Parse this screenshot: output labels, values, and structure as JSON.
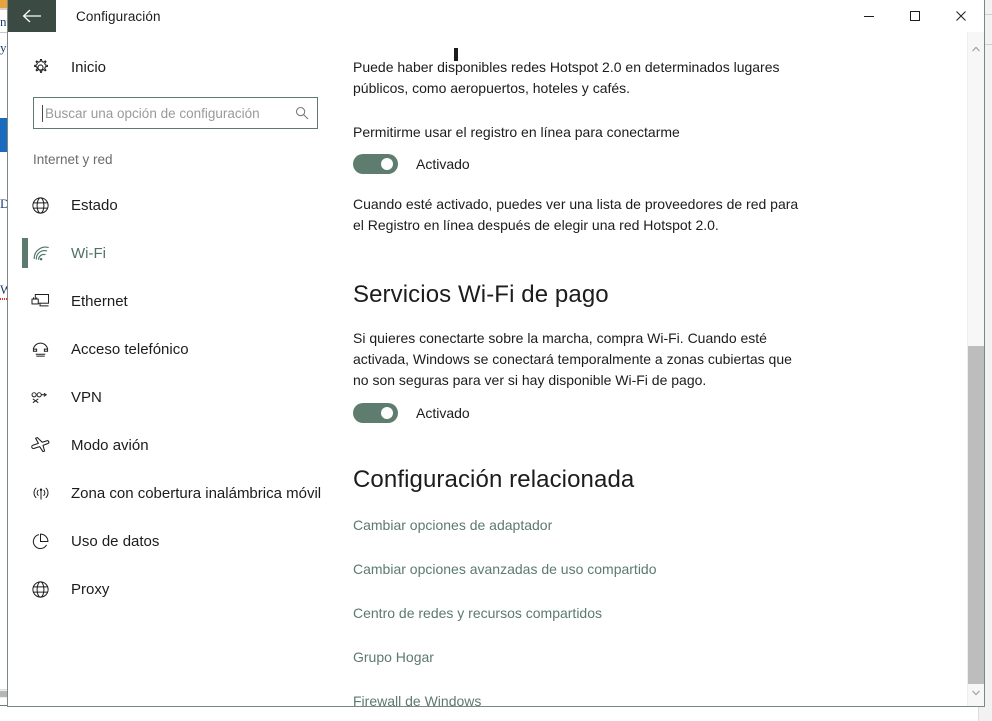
{
  "window": {
    "title": "Configuración",
    "back_icon": "back-arrow-icon",
    "minimize_label": "Minimizar",
    "maximize_label": "Maximizar",
    "close_label": "Cerrar"
  },
  "sidebar": {
    "home": {
      "label": "Inicio",
      "icon": "gear-icon"
    },
    "search": {
      "placeholder": "Buscar una opción de configuración",
      "value": "",
      "icon": "search-icon"
    },
    "section_title": "Internet y red",
    "items": [
      {
        "label": "Estado",
        "icon": "globe-icon",
        "selected": false
      },
      {
        "label": "Wi-Fi",
        "icon": "wifi-icon",
        "selected": true
      },
      {
        "label": "Ethernet",
        "icon": "ethernet-icon",
        "selected": false
      },
      {
        "label": "Acceso telefónico",
        "icon": "dialup-phone-icon",
        "selected": false
      },
      {
        "label": "VPN",
        "icon": "vpn-icon",
        "selected": false
      },
      {
        "label": "Modo avión",
        "icon": "airplane-icon",
        "selected": false
      },
      {
        "label": "Zona con cobertura inalámbrica móvil",
        "icon": "hotspot-icon",
        "selected": false
      },
      {
        "label": "Uso de datos",
        "icon": "pie-chart-icon",
        "selected": false
      },
      {
        "label": "Proxy",
        "icon": "globe-icon",
        "selected": false
      }
    ]
  },
  "content": {
    "hotspot_description": "Puede haber disponibles redes Hotspot 2.0 en determinados lugares públicos, como aeropuertos, hoteles y cafés.",
    "online_signup_label": "Permitirme usar el registro en línea para conectarme",
    "online_signup_toggle": "Activado",
    "online_signup_help": "Cuando esté activado, puedes ver una lista de proveedores de red para el Registro en línea después de elegir una red Hotspot 2.0.",
    "paid_services_heading": "Servicios Wi-Fi de pago",
    "paid_services_description": "Si quieres conectarte sobre la marcha, compra Wi-Fi. Cuando esté activada, Windows se conectará temporalmente a zonas cubiertas que no son seguras para ver si hay disponible Wi-Fi de pago.",
    "paid_services_toggle": "Activado",
    "related_heading": "Configuración relacionada",
    "related_links": [
      "Cambiar opciones de adaptador",
      "Cambiar opciones avanzadas de uso compartido",
      "Centro de redes y recursos compartidos",
      "Grupo Hogar",
      "Firewall de Windows"
    ]
  },
  "scrollbar": {
    "up_icon": "chevron-up-icon",
    "down_icon": "chevron-down-icon"
  },
  "background_window": {
    "fragments": [
      "nt",
      "y",
      "D",
      "W"
    ]
  },
  "colors": {
    "accent": "#5c7a6d",
    "titlebar_back": "#3b4a42",
    "toggle_on": "#5e7d6e",
    "link": "#5c7a6d",
    "text": "#1c1c1c",
    "muted_text": "#6b6b6b"
  }
}
